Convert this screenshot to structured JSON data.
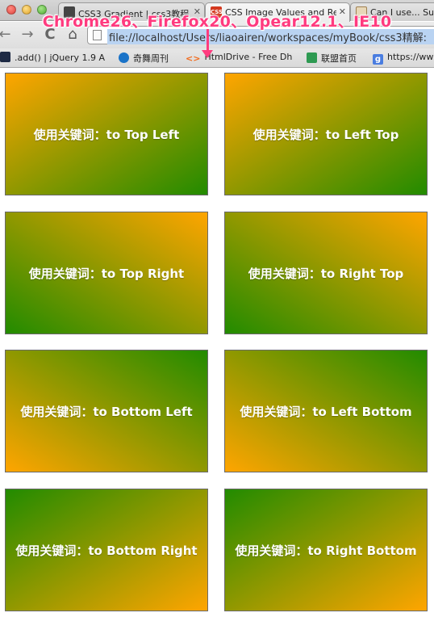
{
  "tabs": [
    {
      "label": "CSS3 Gradient | css3教程",
      "icon": "dark-page-icon"
    },
    {
      "label": "CSS Image Values and Re",
      "icon": "css-icon"
    },
    {
      "label": "Can I use... Sup",
      "icon": "page-icon"
    }
  ],
  "toolbar": {
    "back": "←",
    "forward": "→",
    "reload": "C",
    "home": "⌂",
    "url": "file://localhost/Users/liaoairen/workspaces/myBook/css3精解:"
  },
  "bookmarks": [
    {
      "label": ".add() | jQuery 1.9 A",
      "icon": "jquery-icon",
      "color": "#1e2a44"
    },
    {
      "label": "奇舞周刊",
      "icon": "qiwu-icon",
      "color": "#1a73c8"
    },
    {
      "label": "HtmlDrive - Free Dh",
      "icon": "htmldrive-icon",
      "color": "#f26b1d"
    },
    {
      "label": "联盟首页",
      "icon": "grid-icon",
      "color": "#2e9a52"
    },
    {
      "label": "https://ww",
      "icon": "google-icon",
      "color": "#4a7de0"
    }
  ],
  "annotation": "Chrome26、Firefox20、Opear12.1、IE10",
  "colors": {
    "green": "#228B00",
    "orange": "#FFA500"
  },
  "boxes": [
    {
      "caption": "使用关键词：to Top Left",
      "direction": "to top left"
    },
    {
      "caption": "使用关键词：to Left Top",
      "direction": "to left top"
    },
    {
      "caption": "使用关键词：to Top Right",
      "direction": "to top right"
    },
    {
      "caption": "使用关键词：to Right Top",
      "direction": "to right top"
    },
    {
      "caption": "使用关键词：to Bottom Left",
      "direction": "to bottom left"
    },
    {
      "caption": "使用关键词：to Left Bottom",
      "direction": "to left bottom"
    },
    {
      "caption": "使用关键词：to Bottom Right",
      "direction": "to bottom right"
    },
    {
      "caption": "使用关键词：to Right Bottom",
      "direction": "to right bottom"
    }
  ]
}
